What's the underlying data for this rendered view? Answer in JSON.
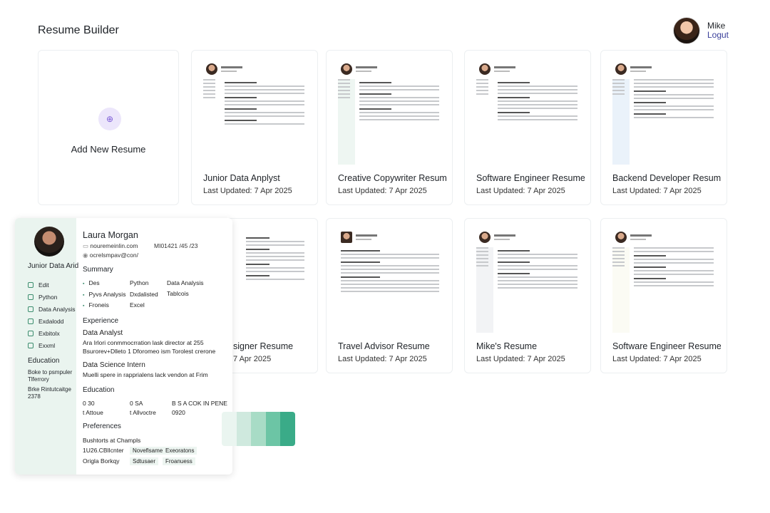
{
  "app": {
    "title": "Resume Builder"
  },
  "user": {
    "name": "Mike",
    "logout_label": "Logut"
  },
  "add_card": {
    "label": "Add New Resume"
  },
  "cards": [
    {
      "title": "Junior Data Anplyst",
      "date": "Last Updated: 7 Apr 2025"
    },
    {
      "title": "Creative Copywriter Resum",
      "date": "Last Updated:  7 Apr 2025"
    },
    {
      "title": "Software Engineer Resume",
      "date": "Last Updated: 7 Apr 2025"
    },
    {
      "title": "Backend Developer Resume",
      "date": "Last Updated: 7 Apr 2025"
    },
    {
      "title": "signer Resume",
      "date": "7 Apr 2025"
    },
    {
      "title": "Travel Advisor Resume",
      "date": "Last Updated: 7 Apr 2025"
    },
    {
      "title": "Mike's Resume",
      "date": "Last Updated: 7 Apr 2025"
    },
    {
      "title": "Software Engineer Resume",
      "date": "Last Updated: 7 Apr 2025"
    }
  ],
  "details": {
    "name": "Laura Morgan",
    "contact_1": "nouremeinlin.com",
    "contact_2": "MI01421 /45 /23",
    "contact_3": "ocrelsmpav@con/",
    "role": "Junior Data Arid",
    "side_items": [
      "Edit",
      "Python",
      "Data Analysis",
      "Exdalodd",
      "Exbitolx",
      "Exxml"
    ],
    "side_education_heading": "Education",
    "side_education": [
      "Boke to psmpuler",
      "Tlferrory",
      "Brke Rintutcaitge",
      "2378"
    ],
    "summary_heading": "Summary",
    "summary_rows": [
      [
        "Des",
        "Python",
        "Data Analysis"
      ],
      [
        "Pyvs Analysis",
        "Dxdalisted",
        "Tablcois"
      ],
      [
        "Froneis",
        "Excel",
        ""
      ]
    ],
    "experience_heading": "Experience",
    "job1_title": "Data Analyst",
    "job1_line1": "Ara Irlori conmmocrration lask director at 255",
    "job1_line2": "Bsurorev+Dlleto 1 Dforomeo ism Torolest crerone",
    "job2_title": "Data Science Intern",
    "job2_line1": "Muelli spere in rapprialens lack vendon at Frim",
    "education_heading": "Education",
    "education_rows": [
      [
        "0 30",
        "0 SA",
        "B S A COK IN PENE"
      ],
      [
        "t Attoue",
        "t Allvoctre",
        "0920"
      ]
    ],
    "preferences_heading": "Preferences",
    "pref_line": "Bushtorts at Champls",
    "pref_rows": [
      [
        "1U26.CBlIcnter",
        "Noveflsames",
        "Exeoratons"
      ],
      [
        "Origla Borkqy",
        "Sdtusaer",
        "Froanuess"
      ]
    ]
  },
  "colors": {
    "accent_green": "#3c8d6e",
    "swatches": [
      "#eaf5f0",
      "#cfe9de",
      "#a8dcc6",
      "#6cc5a5",
      "#3aab88"
    ]
  }
}
